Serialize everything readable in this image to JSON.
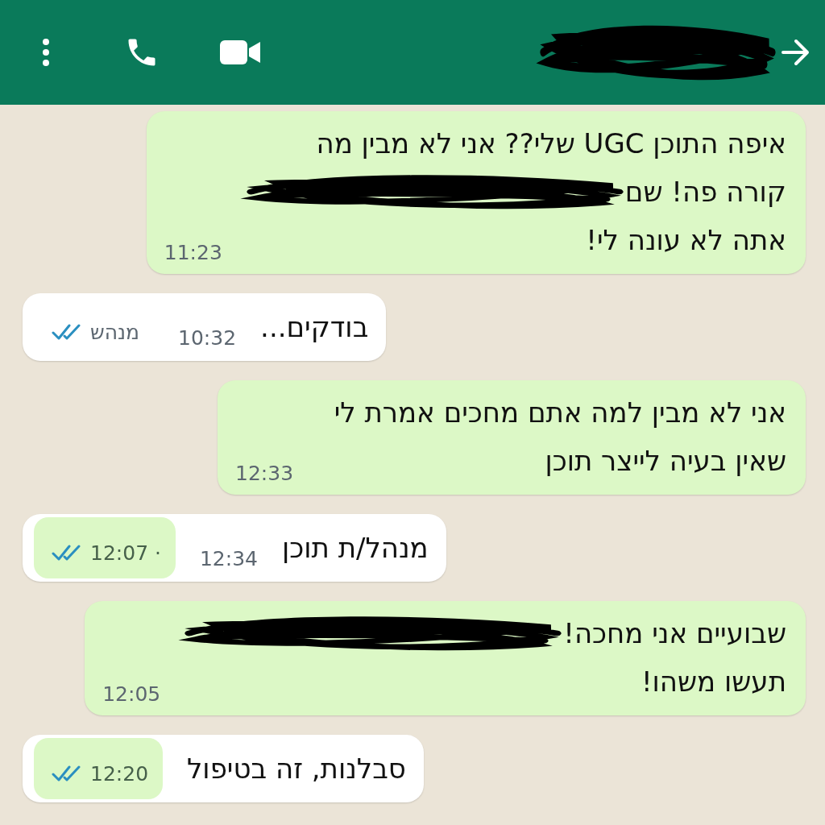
{
  "header": {
    "contact_redacted": true
  },
  "messages": [
    {
      "kind": "sent",
      "lines": [
        {
          "text": "איפה התוכן UGC שלי?? אני לא מבין מה",
          "redacted": false
        },
        {
          "text": "קורה פה! שם",
          "redacted": true
        },
        {
          "text": "אתה לא עונה לי!",
          "redacted": false
        }
      ],
      "time": "11:23"
    },
    {
      "kind": "received",
      "text": "בודקים...",
      "time": "10:32",
      "receipt": {
        "text": "מנהש",
        "read": true,
        "highlighted": false
      }
    },
    {
      "kind": "sent",
      "lines": [
        {
          "text": "אני לא מבין למה אתם מחכים אמרת לי",
          "redacted": false
        },
        {
          "text": "שאין בעיה לייצר תוכן",
          "redacted": false
        }
      ],
      "time": "12:33"
    },
    {
      "kind": "received",
      "text": "מנהל/ת תוכן",
      "time": "12:34",
      "receipt": {
        "text": "12:07 ·",
        "read": true,
        "highlighted": true
      }
    },
    {
      "kind": "sent",
      "lines": [
        {
          "text": "שבועיים אני מחכה!",
          "redacted": true
        },
        {
          "text": "תעשו משהו!",
          "redacted": false
        }
      ],
      "time": "12:05"
    },
    {
      "kind": "received",
      "text": "סבלנות, זה בטיפול",
      "receipt": {
        "text": "12:20",
        "read": true,
        "highlighted": true
      }
    }
  ]
}
